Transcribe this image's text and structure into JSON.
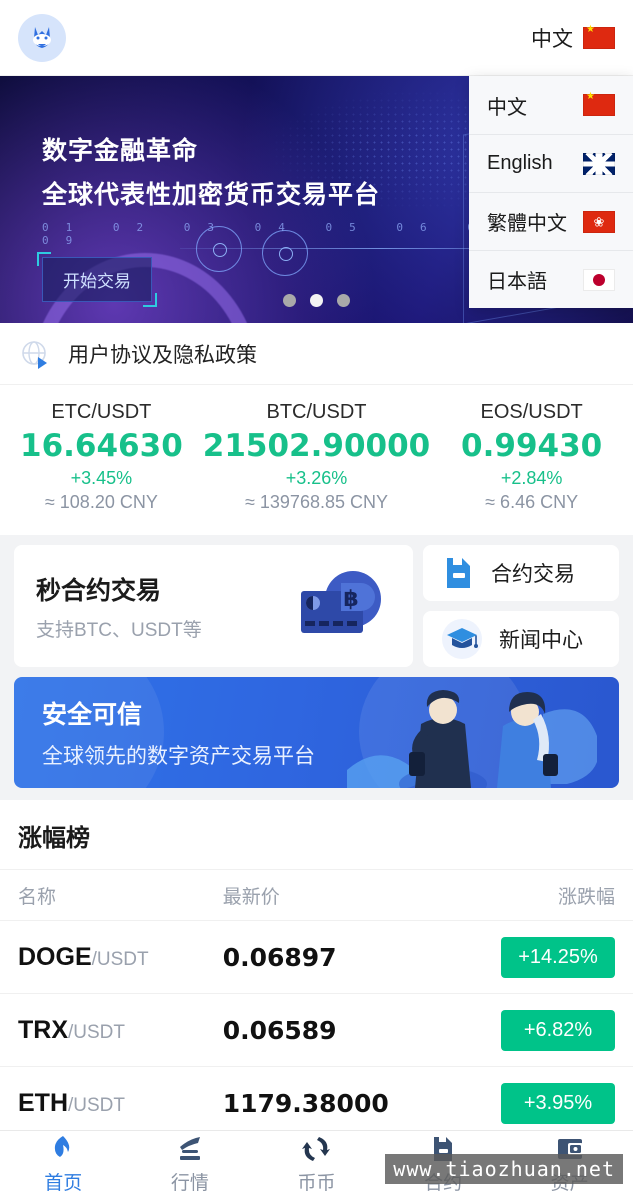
{
  "header": {
    "logo_alt": "exchange-logo",
    "language_label": "中文",
    "language_flag": "cn"
  },
  "language_menu": {
    "items": [
      {
        "label": "中文",
        "flag": "cn"
      },
      {
        "label": "English",
        "flag": "gb"
      },
      {
        "label": "繁體中文",
        "flag": "hk"
      },
      {
        "label": "日本語",
        "flag": "jp"
      }
    ]
  },
  "hero": {
    "title_line1": "数字金融革命",
    "title_line2": "全球代表性加密货币交易平台",
    "numbers": "01 02 03 04 05 06 07 08 09",
    "cta_label": "开始交易",
    "dots_total": 3,
    "dot_active_index": 1
  },
  "notice": {
    "text": "用户协议及隐私政策",
    "icon": "globe-arrow-icon"
  },
  "tickers": [
    {
      "pair": "ETC/USDT",
      "price": "16.64630",
      "change": "+3.45%",
      "cny": "≈ 108.20 CNY"
    },
    {
      "pair": "BTC/USDT",
      "price": "21502.90000",
      "change": "+3.26%",
      "cny": "≈ 139768.85 CNY"
    },
    {
      "pair": "EOS/USDT",
      "price": "0.99430",
      "change": "+2.84%",
      "cny": "≈ 6.46 CNY"
    }
  ],
  "features": {
    "main": {
      "title": "秒合约交易",
      "subtitle": "支持BTC、USDT等",
      "icon": "bitcoin-card-icon"
    },
    "side": [
      {
        "label": "合约交易",
        "icon": "contract-document-icon"
      },
      {
        "label": "新闻中心",
        "icon": "graduation-cap-icon"
      }
    ]
  },
  "promo": {
    "title": "安全可信",
    "subtitle": "全球领先的数字资产交易平台",
    "icon": "people-illustration"
  },
  "ranking": {
    "title": "涨幅榜",
    "columns": [
      "名称",
      "最新价",
      "涨跌幅"
    ],
    "rows": [
      {
        "base": "DOGE",
        "quote": "/USDT",
        "price": "0.06897",
        "change": "+14.25%"
      },
      {
        "base": "TRX",
        "quote": "/USDT",
        "price": "0.06589",
        "change": "+6.82%"
      },
      {
        "base": "ETH",
        "quote": "/USDT",
        "price": "1179.38000",
        "change": "+3.95%"
      }
    ]
  },
  "tabbar": {
    "items": [
      {
        "label": "首页",
        "icon": "flame-icon",
        "active": true
      },
      {
        "label": "行情",
        "icon": "market-chart-icon",
        "active": false
      },
      {
        "label": "币币",
        "icon": "exchange-arrows-icon",
        "active": false
      },
      {
        "label": "合约",
        "icon": "contract-document-icon",
        "active": false
      },
      {
        "label": "资产",
        "icon": "wallet-icon",
        "active": false
      }
    ]
  },
  "watermark": {
    "text": "www.tiaozhuan.net"
  },
  "colors": {
    "up_green": "#17c08a",
    "badge_green": "#00c389",
    "brand_blue": "#2f7de1",
    "muted": "#8b94a3"
  }
}
